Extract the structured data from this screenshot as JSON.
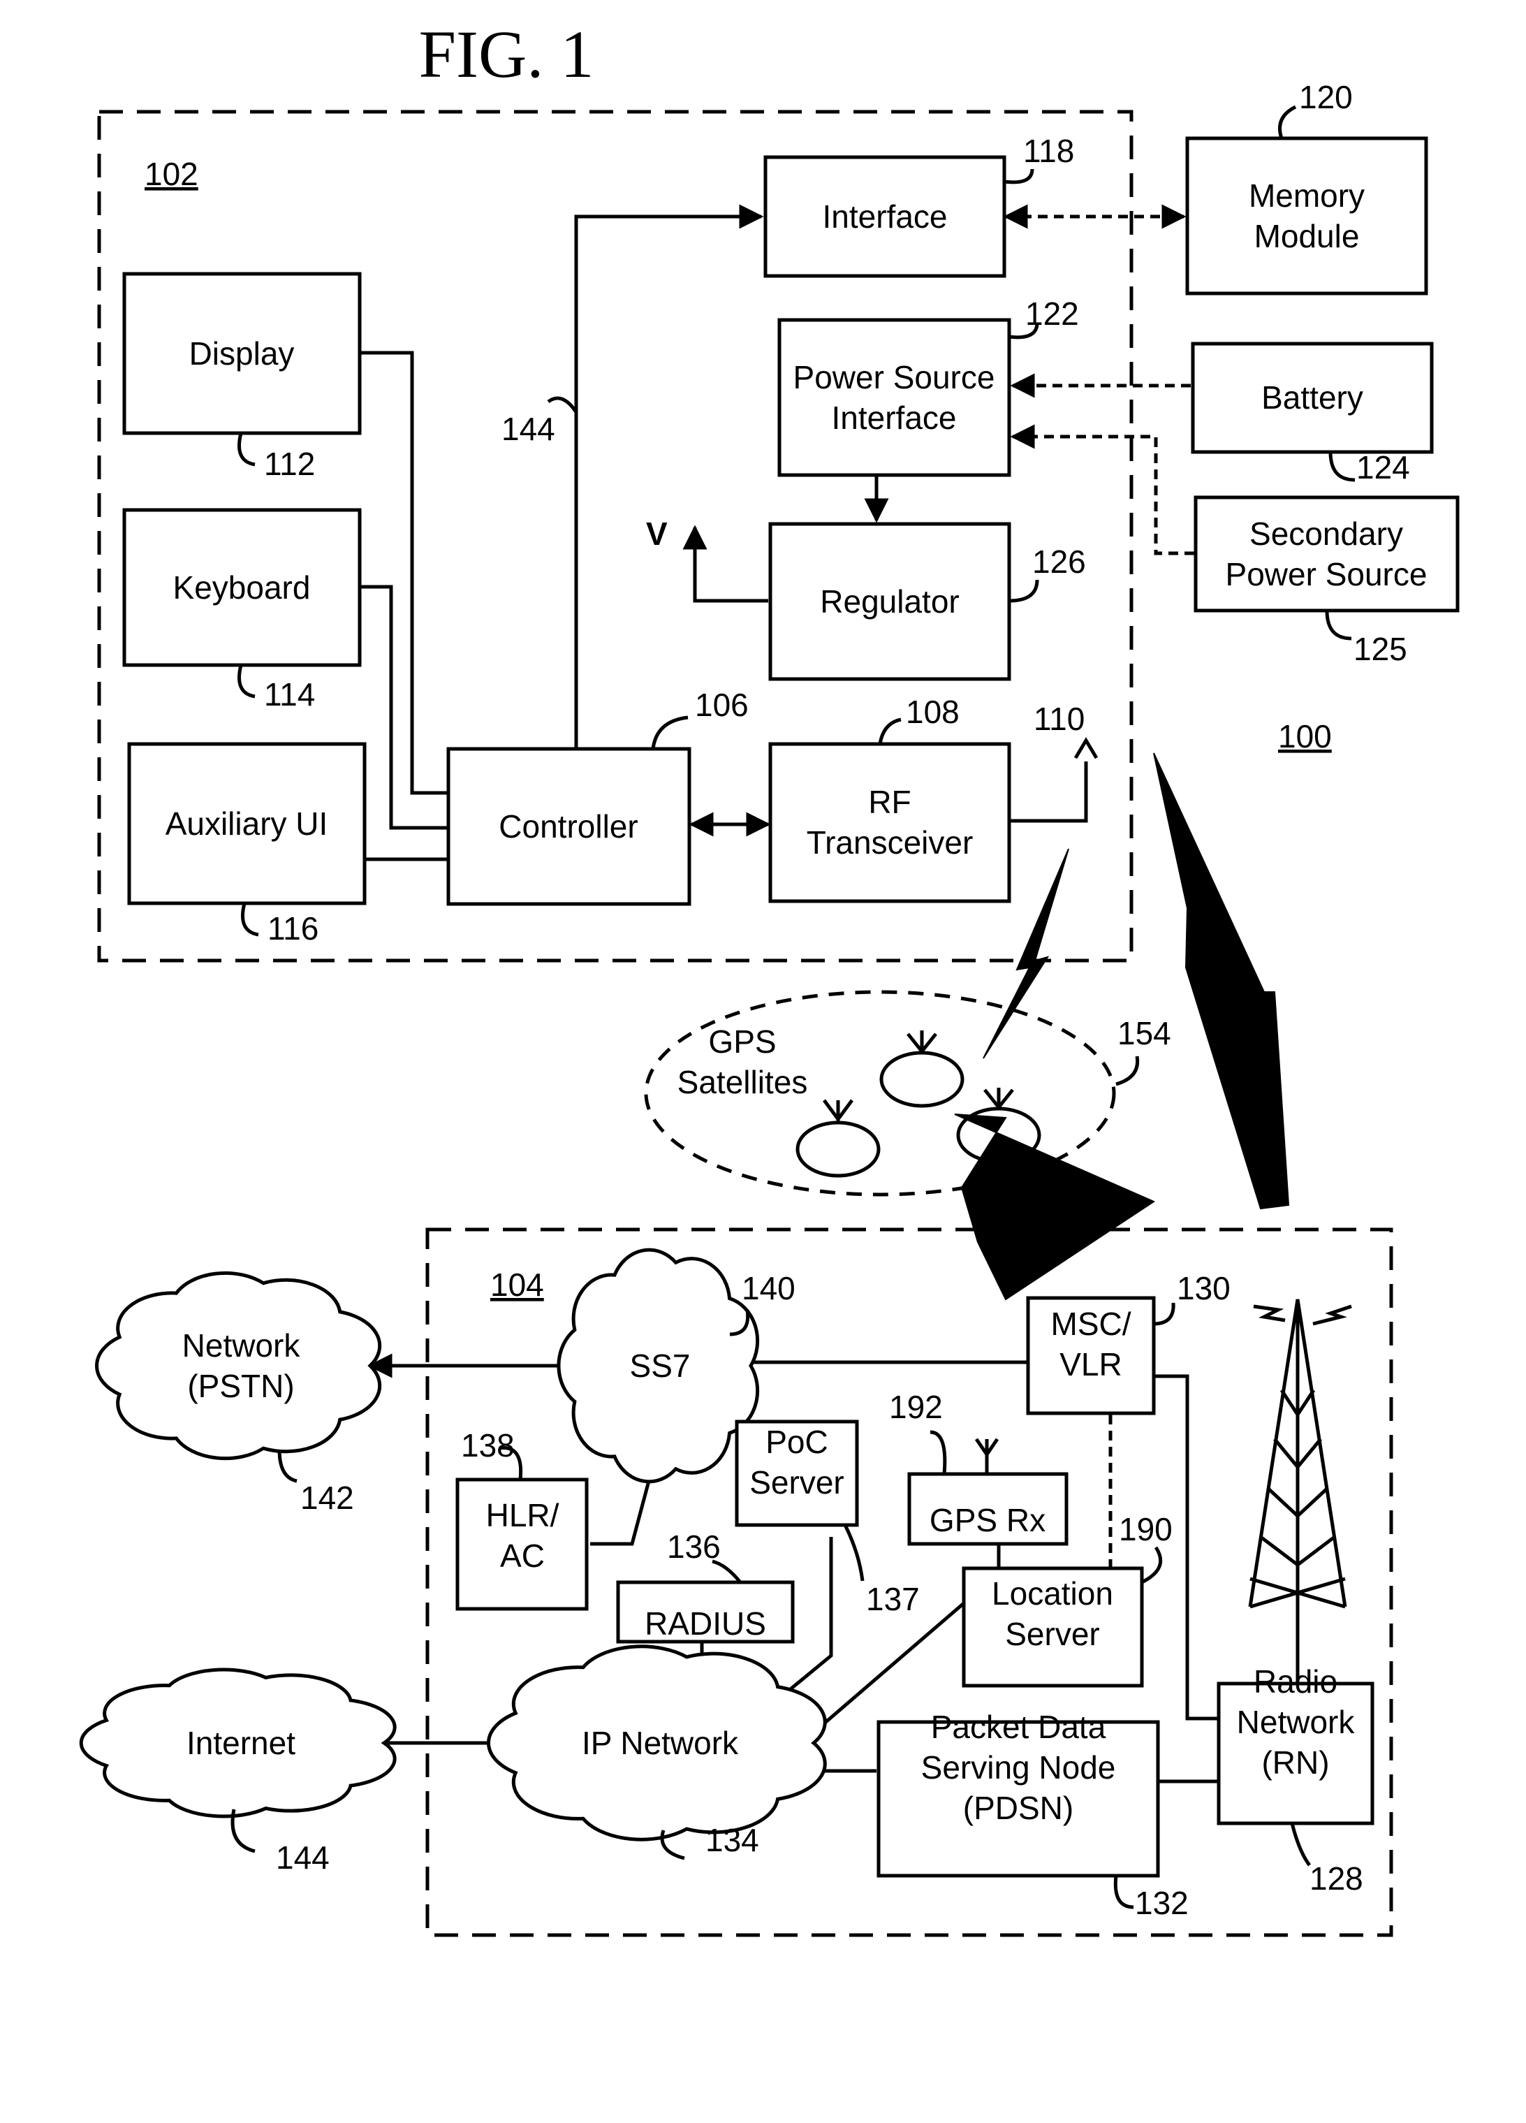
{
  "figure": {
    "title": "FIG. 1",
    "system_ref": "100"
  },
  "device": {
    "ref": "102",
    "blocks": {
      "display": {
        "label": [
          "Display"
        ],
        "ref": "112"
      },
      "keyboard": {
        "label": [
          "Keyboard"
        ],
        "ref": "114"
      },
      "auxiliary_ui": {
        "label": [
          "Auxiliary UI"
        ],
        "ref": "116"
      },
      "controller": {
        "label": [
          "Controller"
        ],
        "ref": "106"
      },
      "rf_transceiver": {
        "label": [
          "RF",
          "Transceiver"
        ],
        "ref": "108"
      },
      "antenna": {
        "ref": "110"
      },
      "interface": {
        "label": [
          "Interface"
        ],
        "ref": "118"
      },
      "power_source_interface": {
        "label": [
          "Power Source",
          "Interface"
        ],
        "ref": "122"
      },
      "regulator": {
        "label": [
          "Regulator"
        ],
        "ref": "126"
      },
      "voltage_output": {
        "label": "V"
      },
      "bus": {
        "ref": "144"
      }
    }
  },
  "external": {
    "memory_module": {
      "label": [
        "Memory",
        "Module"
      ],
      "ref": "120"
    },
    "battery": {
      "label": [
        "Battery"
      ],
      "ref": "124"
    },
    "secondary_power_source": {
      "label": [
        "Secondary",
        "Power Source"
      ],
      "ref": "125"
    }
  },
  "gps": {
    "label": [
      "GPS",
      "Satellites"
    ],
    "ref": "154"
  },
  "network": {
    "ref": "104",
    "nodes": {
      "pstn": {
        "label": [
          "Network",
          "(PSTN)"
        ],
        "ref": "142"
      },
      "ss7": {
        "label": [
          "SS7"
        ],
        "ref": "140"
      },
      "msc_vlr": {
        "label": [
          "MSC/",
          "VLR"
        ],
        "ref": "130"
      },
      "hlr_ac": {
        "label": [
          "HLR/",
          "AC"
        ],
        "ref": "138"
      },
      "poc_server": {
        "label": [
          "PoC",
          "Server"
        ],
        "ref": "137"
      },
      "gps_rx": {
        "label": [
          "GPS Rx"
        ],
        "ref": "192"
      },
      "radius": {
        "label": [
          "RADIUS"
        ],
        "ref": "136"
      },
      "location_server": {
        "label": [
          "Location",
          "Server"
        ],
        "ref": "190"
      },
      "internet": {
        "label": [
          "Internet"
        ],
        "ref": "144"
      },
      "ip_network": {
        "label": [
          "IP Network"
        ],
        "ref": "134"
      },
      "pdsn": {
        "label": [
          "Packet Data",
          "Serving Node",
          "(PDSN)"
        ],
        "ref": "132"
      },
      "radio_network": {
        "label": [
          "Radio",
          "Network",
          "(RN)"
        ],
        "ref": "128"
      }
    }
  }
}
